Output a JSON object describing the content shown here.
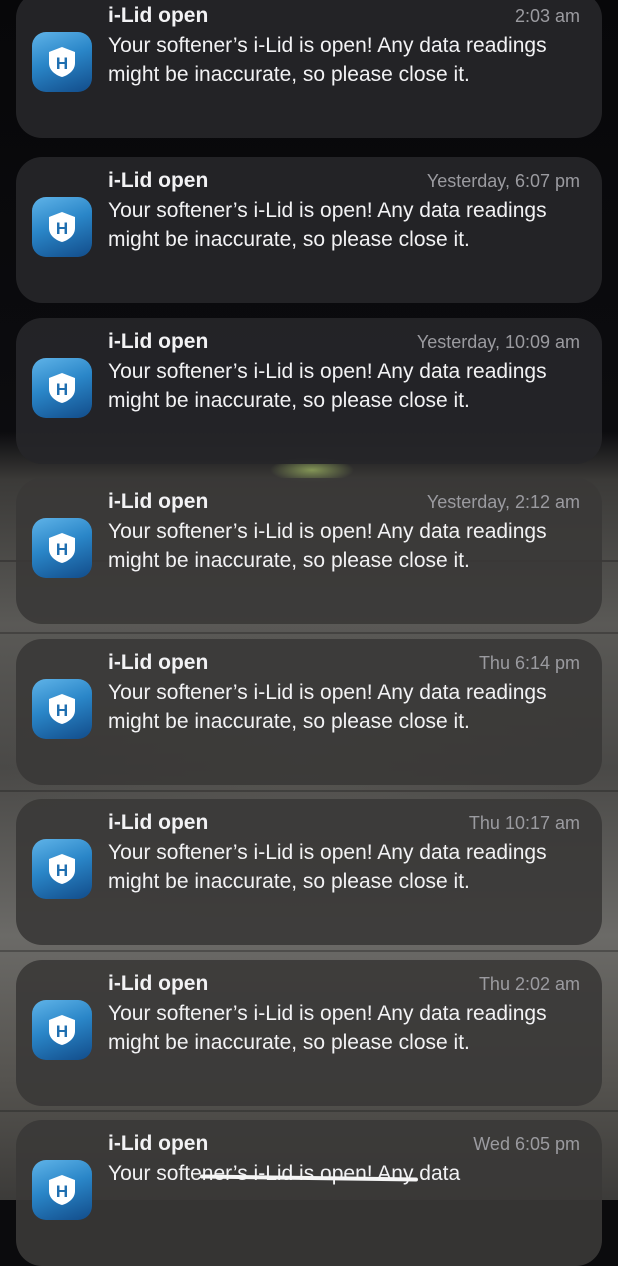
{
  "app": {
    "icon": "h-shield-app-icon",
    "icon_letter": "H"
  },
  "notifications": [
    {
      "title": "i-Lid open",
      "time": "2:03 am",
      "body": "Your softener’s i-Lid is open! Any data readings might be inaccurate, so please close it."
    },
    {
      "title": "i-Lid open",
      "time": "Yesterday, 6:07 pm",
      "body": "Your softener’s i-Lid is open! Any data readings might be inaccurate, so please close it."
    },
    {
      "title": "i-Lid open",
      "time": "Yesterday, 10:09 am",
      "body": "Your softener’s i-Lid is open! Any data readings might be inaccurate, so please close it."
    },
    {
      "title": "i-Lid open",
      "time": "Yesterday, 2:12 am",
      "body": "Your softener’s i-Lid is open! Any data readings might be inaccurate, so please close it."
    },
    {
      "title": "i-Lid open",
      "time": "Thu 6:14 pm",
      "body": "Your softener’s i-Lid is open! Any data readings might be inaccurate, so please close it."
    },
    {
      "title": "i-Lid open",
      "time": "Thu 10:17 am",
      "body": "Your softener’s i-Lid is open! Any data readings might be inaccurate, so please close it."
    },
    {
      "title": "i-Lid open",
      "time": "Thu 2:02 am",
      "body": "Your softener’s i-Lid is open! Any data readings might be inaccurate, so please close it."
    },
    {
      "title": "i-Lid open",
      "time": "Wed 6:05 pm",
      "body": "Your softener’s i-Lid is open! Any data"
    }
  ]
}
